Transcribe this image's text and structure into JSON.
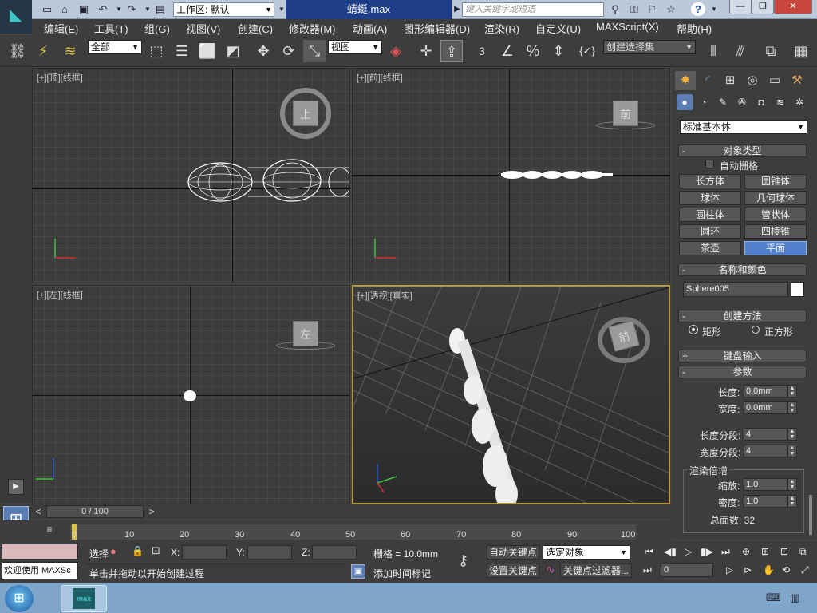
{
  "app": {
    "workspace_label": "工作区: 默认",
    "doc_title": "蜻蜓.max",
    "search_placeholder": "键入关键字或短语",
    "logo_text": "max"
  },
  "menu": [
    "编辑(E)",
    "工具(T)",
    "组(G)",
    "视图(V)",
    "创建(C)",
    "修改器(M)",
    "动画(A)",
    "图形编辑器(D)",
    "渲染(R)",
    "自定义(U)",
    "MAXScript(X)",
    "帮助(H)"
  ],
  "toolbar": {
    "filter_value": "全部",
    "refcoord_value": "视图",
    "snap_label": "3",
    "selection_set_value": "创建选择集"
  },
  "viewports": {
    "top": {
      "plus": "[+]",
      "name": "[顶]",
      "shade": "[线框]",
      "cube_label": "上"
    },
    "front": {
      "plus": "[+]",
      "name": "[前]",
      "shade": "[线框]",
      "cube_label": "前"
    },
    "left": {
      "plus": "[+]",
      "name": "[左]",
      "shade": "[线框]",
      "cube_label": "左"
    },
    "persp": {
      "plus": "[+]",
      "name": "[透视]",
      "shade": "[真实]",
      "cube_label": "前"
    }
  },
  "command_panel": {
    "category_value": "标准基本体",
    "object_type_title": "对象类型",
    "autogrid_label": "自动栅格",
    "buttons": [
      "长方体",
      "圆锥体",
      "球体",
      "几何球体",
      "圆柱体",
      "管状体",
      "圆环",
      "四棱锥",
      "茶壶",
      "平面"
    ],
    "active_button": "平面",
    "name_color_title": "名称和颜色",
    "object_name": "Sphere005",
    "object_color": "#ffffff",
    "creation_method_title": "创建方法",
    "method_options": [
      "矩形",
      "正方形"
    ],
    "keyboard_title": "键盘输入",
    "params_title": "参数",
    "length_label": "长度:",
    "length_value": "0.0mm",
    "width_label": "宽度:",
    "width_value": "0.0mm",
    "length_segs_label": "长度分段:",
    "length_segs_value": "4",
    "width_segs_label": "宽度分段:",
    "width_segs_value": "4",
    "render_mult_title": "渲染倍增",
    "scale_label": "缩放:",
    "scale_value": "1.0",
    "density_label": "密度:",
    "density_value": "1.0",
    "total_faces": "总面数: 32"
  },
  "timeline": {
    "frame_text": "0 / 100",
    "ticks": [
      "0",
      "10",
      "20",
      "30",
      "40",
      "50",
      "60",
      "70",
      "80",
      "90",
      "100"
    ]
  },
  "status": {
    "welcome_text": "欢迎使用 MAXSc",
    "select_label": "选择",
    "x_label": "X:",
    "y_label": "Y:",
    "z_label": "Z:",
    "grid_text": "栅格 = 10.0mm",
    "autokey_label": "自动关键点",
    "setkey_label": "设置关键点",
    "key_mode_value": "选定对象",
    "key_filter_label": "关键点过滤器...",
    "frame_value": "0",
    "prompt_text": "单击并拖动以开始创建过程",
    "add_time_tag": "添加时间标记"
  },
  "taskbar": {
    "app_label": "max"
  }
}
